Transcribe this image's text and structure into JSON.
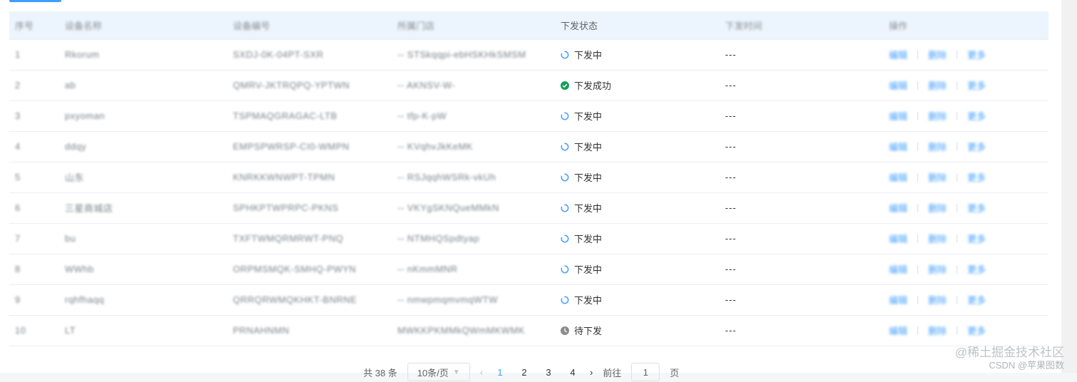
{
  "table": {
    "headers": [
      "序号",
      "设备名称",
      "设备编号",
      "所属门店",
      "下发状态",
      "下发时间",
      "操作"
    ],
    "rows": [
      {
        "idx": "1",
        "name": "Rkorum",
        "code": "SXDJ-0K-04PT-SXR",
        "store": "-- STSkqqpi-ebHSKHkSMSM",
        "status": "下发中",
        "status_kind": "pending",
        "time": "---",
        "ops": [
          "编辑",
          "删除",
          "更多"
        ]
      },
      {
        "idx": "2",
        "name": "ab",
        "code": "QMRV-JKTRQPQ-YPTWN",
        "store": "-- AKNSV-W-",
        "status": "下发成功",
        "status_kind": "success",
        "time": "---",
        "ops": [
          "编辑",
          "删除",
          "更多"
        ]
      },
      {
        "idx": "3",
        "name": "pxyoman",
        "code": "TSPMAQGRAGAC-LTB",
        "store": "-- tfp-K-pW",
        "status": "下发中",
        "status_kind": "pending",
        "time": "---",
        "ops": [
          "编辑",
          "删除",
          "更多"
        ]
      },
      {
        "idx": "4",
        "name": "ddqy",
        "code": "EMPSPWRSP-CI0-WMPN",
        "store": "-- KVqhvJkKeMK",
        "status": "下发中",
        "status_kind": "pending",
        "time": "---",
        "ops": [
          "编辑",
          "删除",
          "更多"
        ]
      },
      {
        "idx": "5",
        "name": "山东",
        "code": "KNRKKWNWPT-TPMN",
        "store": "-- RSJqqhWSRk-vkUh",
        "status": "下发中",
        "status_kind": "pending",
        "time": "---",
        "ops": [
          "编辑",
          "删除",
          "更多"
        ]
      },
      {
        "idx": "6",
        "name": "三星商城店",
        "code": "SPHKPTWPRPC-PKNS",
        "store": "-- VKYgSKNQueMMkN",
        "status": "下发中",
        "status_kind": "pending",
        "time": "---",
        "ops": [
          "编辑",
          "删除",
          "更多"
        ]
      },
      {
        "idx": "7",
        "name": "bu",
        "code": "TXFTWMQRMRWT-PNQ",
        "store": "-- NTMHQSpdtyap",
        "status": "下发中",
        "status_kind": "pending",
        "time": "---",
        "ops": [
          "编辑",
          "删除",
          "更多"
        ]
      },
      {
        "idx": "8",
        "name": "WWhb",
        "code": "ORPMSMQK-SMHQ-PWYN",
        "store": "-- nKmmMNR",
        "status": "下发中",
        "status_kind": "pending",
        "time": "---",
        "ops": [
          "编辑",
          "删除",
          "更多"
        ]
      },
      {
        "idx": "9",
        "name": "rqhfhaqq",
        "code": "QRRQRWMQKHKT-BNRNE",
        "store": "-- nmwpmqmvmqWTW",
        "status": "下发中",
        "status_kind": "pending",
        "time": "---",
        "ops": [
          "编辑",
          "删除",
          "更多"
        ]
      },
      {
        "idx": "10",
        "name": "LT",
        "code": "PRNAHNMN",
        "store": "MWKKPKMMkQWmMKWMK",
        "status": "待下发",
        "status_kind": "waiting",
        "time": "---",
        "ops": [
          "编辑",
          "删除",
          "更多"
        ]
      }
    ]
  },
  "pagination": {
    "total_text": "共 38 条",
    "page_size": "10条/页",
    "pages": [
      "1",
      "2",
      "3",
      "4"
    ],
    "current": "1",
    "goto_label": "前往",
    "goto_value": "1",
    "goto_suffix": "页"
  },
  "watermark": {
    "line1": "@稀土掘金技术社区",
    "line2": "CSDN @苹果图数"
  },
  "colors": {
    "primary": "#409eff",
    "success": "#13a05a",
    "header_bg": "#ecf5fd",
    "waiting": "#8c8c8c"
  }
}
